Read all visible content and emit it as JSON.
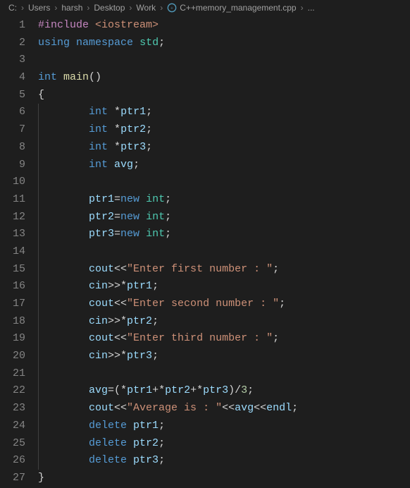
{
  "breadcrumb": {
    "items": [
      "C:",
      "Users",
      "harsh",
      "Desktop",
      "Work"
    ],
    "file": "C++memory_management.cpp",
    "trail": "..."
  },
  "code": {
    "lines": [
      {
        "n": 1,
        "i": 0,
        "t": [
          {
            "c": "c-pre",
            "s": "#include"
          },
          {
            "c": "c-pn",
            "s": " "
          },
          {
            "c": "c-inc",
            "s": "<iostream>"
          }
        ]
      },
      {
        "n": 2,
        "i": 0,
        "t": [
          {
            "c": "c-kw",
            "s": "using"
          },
          {
            "c": "c-pn",
            "s": " "
          },
          {
            "c": "c-kw",
            "s": "namespace"
          },
          {
            "c": "c-pn",
            "s": " "
          },
          {
            "c": "c-ns",
            "s": "std"
          },
          {
            "c": "c-pn",
            "s": ";"
          }
        ]
      },
      {
        "n": 3,
        "i": 0,
        "t": []
      },
      {
        "n": 4,
        "i": 0,
        "t": [
          {
            "c": "c-type",
            "s": "int"
          },
          {
            "c": "c-pn",
            "s": " "
          },
          {
            "c": "c-fn",
            "s": "main"
          },
          {
            "c": "c-pn",
            "s": "()"
          }
        ]
      },
      {
        "n": 5,
        "i": 0,
        "t": [
          {
            "c": "c-pn",
            "s": "{"
          }
        ]
      },
      {
        "n": 6,
        "i": 2,
        "t": [
          {
            "c": "c-type",
            "s": "int"
          },
          {
            "c": "c-pn",
            "s": " "
          },
          {
            "c": "c-op",
            "s": "*"
          },
          {
            "c": "c-var",
            "s": "ptr1"
          },
          {
            "c": "c-pn",
            "s": ";"
          }
        ]
      },
      {
        "n": 7,
        "i": 2,
        "t": [
          {
            "c": "c-type",
            "s": "int"
          },
          {
            "c": "c-pn",
            "s": " "
          },
          {
            "c": "c-op",
            "s": "*"
          },
          {
            "c": "c-var",
            "s": "ptr2"
          },
          {
            "c": "c-pn",
            "s": ";"
          }
        ]
      },
      {
        "n": 8,
        "i": 2,
        "t": [
          {
            "c": "c-type",
            "s": "int"
          },
          {
            "c": "c-pn",
            "s": " "
          },
          {
            "c": "c-op",
            "s": "*"
          },
          {
            "c": "c-var",
            "s": "ptr3"
          },
          {
            "c": "c-pn",
            "s": ";"
          }
        ]
      },
      {
        "n": 9,
        "i": 2,
        "t": [
          {
            "c": "c-type",
            "s": "int"
          },
          {
            "c": "c-pn",
            "s": " "
          },
          {
            "c": "c-var",
            "s": "avg"
          },
          {
            "c": "c-pn",
            "s": ";"
          }
        ]
      },
      {
        "n": 10,
        "i": 1,
        "t": []
      },
      {
        "n": 11,
        "i": 2,
        "t": [
          {
            "c": "c-var",
            "s": "ptr1"
          },
          {
            "c": "c-op",
            "s": "="
          },
          {
            "c": "c-new",
            "s": "new"
          },
          {
            "c": "c-pn",
            "s": " "
          },
          {
            "c": "c-ty2",
            "s": "int"
          },
          {
            "c": "c-pn",
            "s": ";"
          }
        ]
      },
      {
        "n": 12,
        "i": 2,
        "t": [
          {
            "c": "c-var",
            "s": "ptr2"
          },
          {
            "c": "c-op",
            "s": "="
          },
          {
            "c": "c-new",
            "s": "new"
          },
          {
            "c": "c-pn",
            "s": " "
          },
          {
            "c": "c-ty2",
            "s": "int"
          },
          {
            "c": "c-pn",
            "s": ";"
          }
        ]
      },
      {
        "n": 13,
        "i": 2,
        "t": [
          {
            "c": "c-var",
            "s": "ptr3"
          },
          {
            "c": "c-op",
            "s": "="
          },
          {
            "c": "c-new",
            "s": "new"
          },
          {
            "c": "c-pn",
            "s": " "
          },
          {
            "c": "c-ty2",
            "s": "int"
          },
          {
            "c": "c-pn",
            "s": ";"
          }
        ]
      },
      {
        "n": 14,
        "i": 1,
        "t": []
      },
      {
        "n": 15,
        "i": 2,
        "t": [
          {
            "c": "c-io",
            "s": "cout"
          },
          {
            "c": "c-op",
            "s": "<<"
          },
          {
            "c": "c-str",
            "s": "\"Enter first number : \""
          },
          {
            "c": "c-pn",
            "s": ";"
          }
        ]
      },
      {
        "n": 16,
        "i": 2,
        "t": [
          {
            "c": "c-io",
            "s": "cin"
          },
          {
            "c": "c-op",
            "s": ">>*"
          },
          {
            "c": "c-var",
            "s": "ptr1"
          },
          {
            "c": "c-pn",
            "s": ";"
          }
        ]
      },
      {
        "n": 17,
        "i": 2,
        "t": [
          {
            "c": "c-io",
            "s": "cout"
          },
          {
            "c": "c-op",
            "s": "<<"
          },
          {
            "c": "c-str",
            "s": "\"Enter second number : \""
          },
          {
            "c": "c-pn",
            "s": ";"
          }
        ]
      },
      {
        "n": 18,
        "i": 2,
        "t": [
          {
            "c": "c-io",
            "s": "cin"
          },
          {
            "c": "c-op",
            "s": ">>*"
          },
          {
            "c": "c-var",
            "s": "ptr2"
          },
          {
            "c": "c-pn",
            "s": ";"
          }
        ]
      },
      {
        "n": 19,
        "i": 2,
        "t": [
          {
            "c": "c-io",
            "s": "cout"
          },
          {
            "c": "c-op",
            "s": "<<"
          },
          {
            "c": "c-str",
            "s": "\"Enter third number : \""
          },
          {
            "c": "c-pn",
            "s": ";"
          }
        ]
      },
      {
        "n": 20,
        "i": 2,
        "t": [
          {
            "c": "c-io",
            "s": "cin"
          },
          {
            "c": "c-op",
            "s": ">>*"
          },
          {
            "c": "c-var",
            "s": "ptr3"
          },
          {
            "c": "c-pn",
            "s": ";"
          }
        ]
      },
      {
        "n": 21,
        "i": 1,
        "t": []
      },
      {
        "n": 22,
        "i": 2,
        "t": [
          {
            "c": "c-var",
            "s": "avg"
          },
          {
            "c": "c-op",
            "s": "=("
          },
          {
            "c": "c-op",
            "s": "*"
          },
          {
            "c": "c-var",
            "s": "ptr1"
          },
          {
            "c": "c-op",
            "s": "+*"
          },
          {
            "c": "c-var",
            "s": "ptr2"
          },
          {
            "c": "c-op",
            "s": "+*"
          },
          {
            "c": "c-var",
            "s": "ptr3"
          },
          {
            "c": "c-op",
            "s": ")/"
          },
          {
            "c": "c-num",
            "s": "3"
          },
          {
            "c": "c-pn",
            "s": ";"
          }
        ]
      },
      {
        "n": 23,
        "i": 2,
        "t": [
          {
            "c": "c-io",
            "s": "cout"
          },
          {
            "c": "c-op",
            "s": "<<"
          },
          {
            "c": "c-str",
            "s": "\"Average is : \""
          },
          {
            "c": "c-op",
            "s": "<<"
          },
          {
            "c": "c-var",
            "s": "avg"
          },
          {
            "c": "c-op",
            "s": "<<"
          },
          {
            "c": "c-io",
            "s": "endl"
          },
          {
            "c": "c-pn",
            "s": ";"
          }
        ]
      },
      {
        "n": 24,
        "i": 2,
        "t": [
          {
            "c": "c-kw",
            "s": "delete"
          },
          {
            "c": "c-pn",
            "s": " "
          },
          {
            "c": "c-var",
            "s": "ptr1"
          },
          {
            "c": "c-pn",
            "s": ";"
          }
        ]
      },
      {
        "n": 25,
        "i": 2,
        "t": [
          {
            "c": "c-kw",
            "s": "delete"
          },
          {
            "c": "c-pn",
            "s": " "
          },
          {
            "c": "c-var",
            "s": "ptr2"
          },
          {
            "c": "c-pn",
            "s": ";"
          }
        ]
      },
      {
        "n": 26,
        "i": 2,
        "t": [
          {
            "c": "c-kw",
            "s": "delete"
          },
          {
            "c": "c-pn",
            "s": " "
          },
          {
            "c": "c-var",
            "s": "ptr3"
          },
          {
            "c": "c-pn",
            "s": ";"
          }
        ]
      },
      {
        "n": 27,
        "i": 0,
        "t": [
          {
            "c": "c-pn",
            "s": "}"
          }
        ]
      }
    ],
    "indent_unit": "    "
  }
}
